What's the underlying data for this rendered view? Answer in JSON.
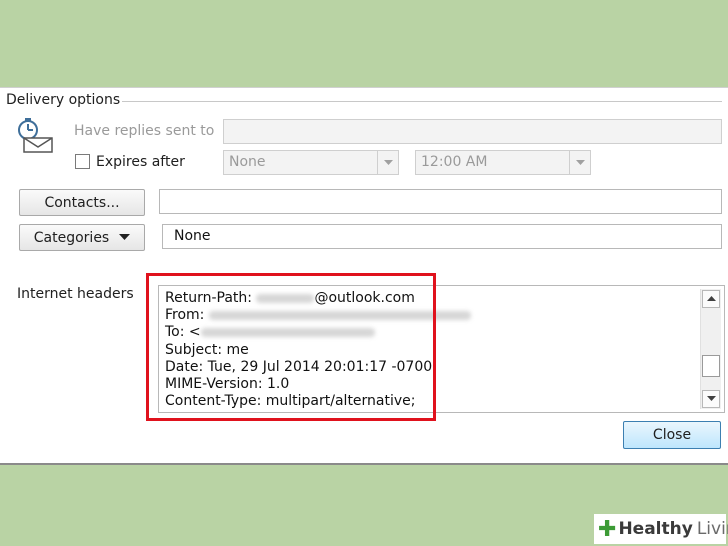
{
  "delivery_options": {
    "title": "Delivery options",
    "have_replies_label": "Have replies sent to",
    "have_replies_value": "",
    "expires_label": "Expires after",
    "expires_checked": false,
    "expires_date": "None",
    "expires_time": "12:00 AM"
  },
  "contacts": {
    "button_label": "Contacts...",
    "value": ""
  },
  "categories": {
    "button_label": "Categories",
    "value": "None"
  },
  "internet_headers": {
    "label": "Internet headers",
    "lines": [
      {
        "prefix": "Return-Path: ",
        "suffix": "@outlook.com"
      },
      {
        "prefix": "From: ",
        "suffix": ""
      },
      {
        "prefix": "To: <",
        "suffix": ""
      },
      {
        "prefix": "Subject: me",
        "suffix": ""
      },
      {
        "prefix": "Date: Tue, 29 Jul 2014 20:01:17 -0700",
        "suffix": ""
      },
      {
        "prefix": "MIME-Version: 1.0",
        "suffix": ""
      },
      {
        "prefix": "Content-Type: multipart/alternative;",
        "suffix": ""
      }
    ]
  },
  "close_button": "Close",
  "watermark": {
    "word1": "Healthy",
    "word2": "Living"
  },
  "colors": {
    "highlight": "#e0121d",
    "background": "#b9d3a4"
  }
}
